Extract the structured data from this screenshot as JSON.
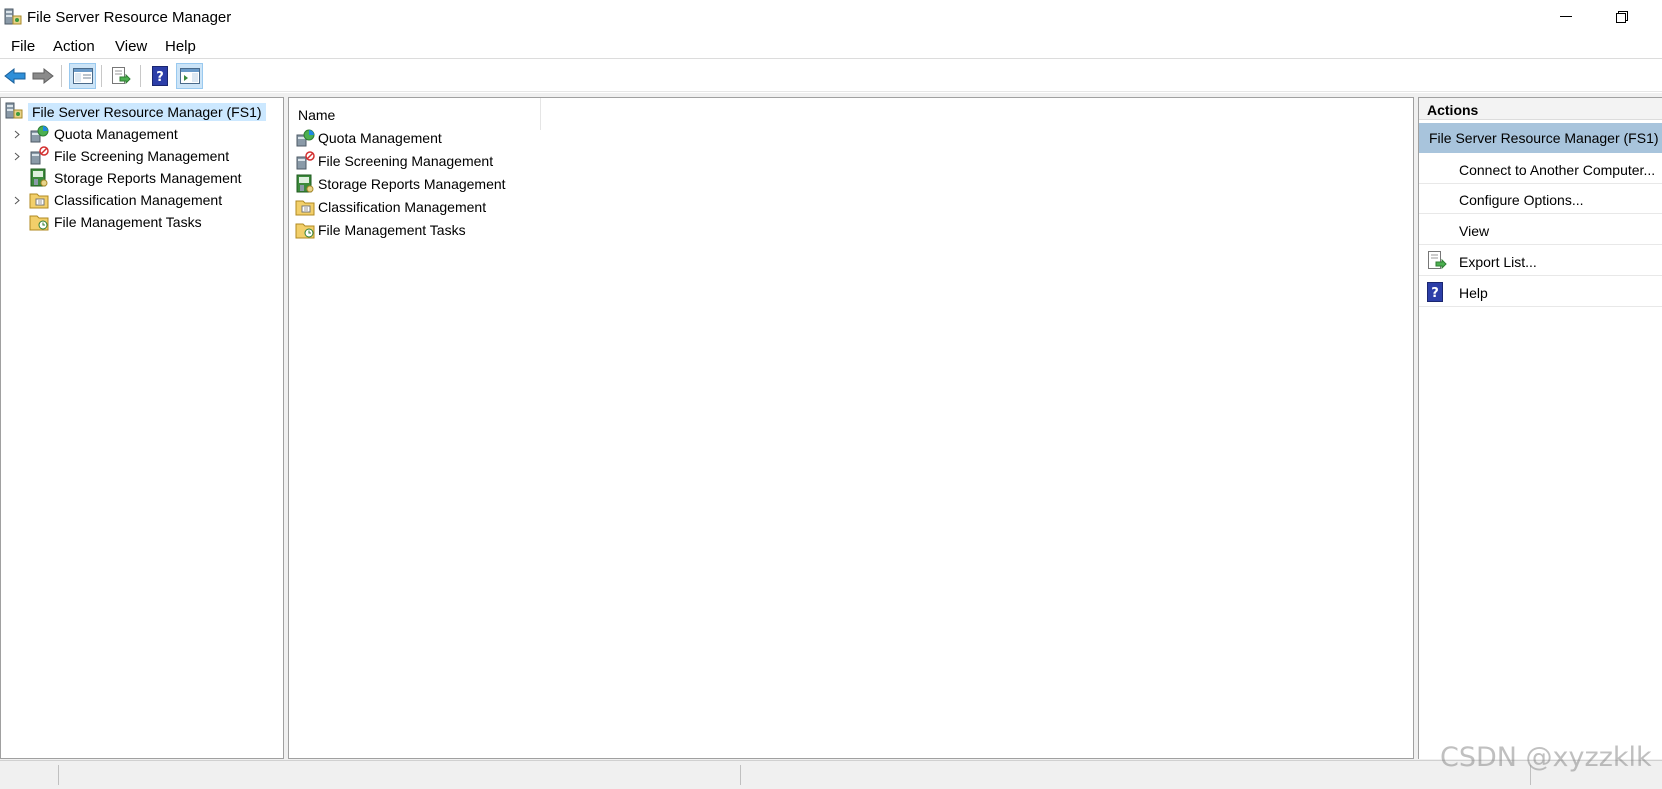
{
  "window": {
    "title": "File Server Resource Manager",
    "icon": "fsrm-server-icon"
  },
  "menu": [
    "File",
    "Action",
    "View",
    "Help"
  ],
  "toolbar": {
    "buttons": [
      "back-arrow-icon",
      "forward-arrow-icon",
      "show-hide-console-tree-icon",
      "export-list-icon",
      "help-icon",
      "show-hide-action-pane-icon"
    ]
  },
  "tree": {
    "root": "File Server Resource Manager (FS1)",
    "nodes": [
      {
        "label": "Quota Management",
        "expandable": true,
        "icon": "quota-icon"
      },
      {
        "label": "File Screening Management",
        "expandable": true,
        "icon": "file-screening-icon"
      },
      {
        "label": "Storage Reports Management",
        "expandable": false,
        "icon": "storage-reports-icon"
      },
      {
        "label": "Classification Management",
        "expandable": true,
        "icon": "classification-folder-icon"
      },
      {
        "label": "File Management Tasks",
        "expandable": false,
        "icon": "file-tasks-folder-icon"
      }
    ]
  },
  "list": {
    "column": "Name",
    "rows": [
      "Quota Management",
      "File Screening Management",
      "Storage Reports Management",
      "Classification Management",
      "File Management Tasks"
    ]
  },
  "actions": {
    "header": "Actions",
    "section": "File Server Resource Manager (FS1)",
    "items": [
      {
        "label": "Connect to Another Computer...",
        "icon": ""
      },
      {
        "label": "Configure Options...",
        "icon": ""
      },
      {
        "label": "View",
        "icon": ""
      },
      {
        "label": "Export List...",
        "icon": "export-list-icon"
      },
      {
        "label": "Help",
        "icon": "help-icon"
      }
    ]
  },
  "watermark": "CSDN @xyzzklk",
  "colors": {
    "selection": "#cce8ff",
    "actions_section": "#a8c4dc",
    "border": "#a0a0a0"
  }
}
